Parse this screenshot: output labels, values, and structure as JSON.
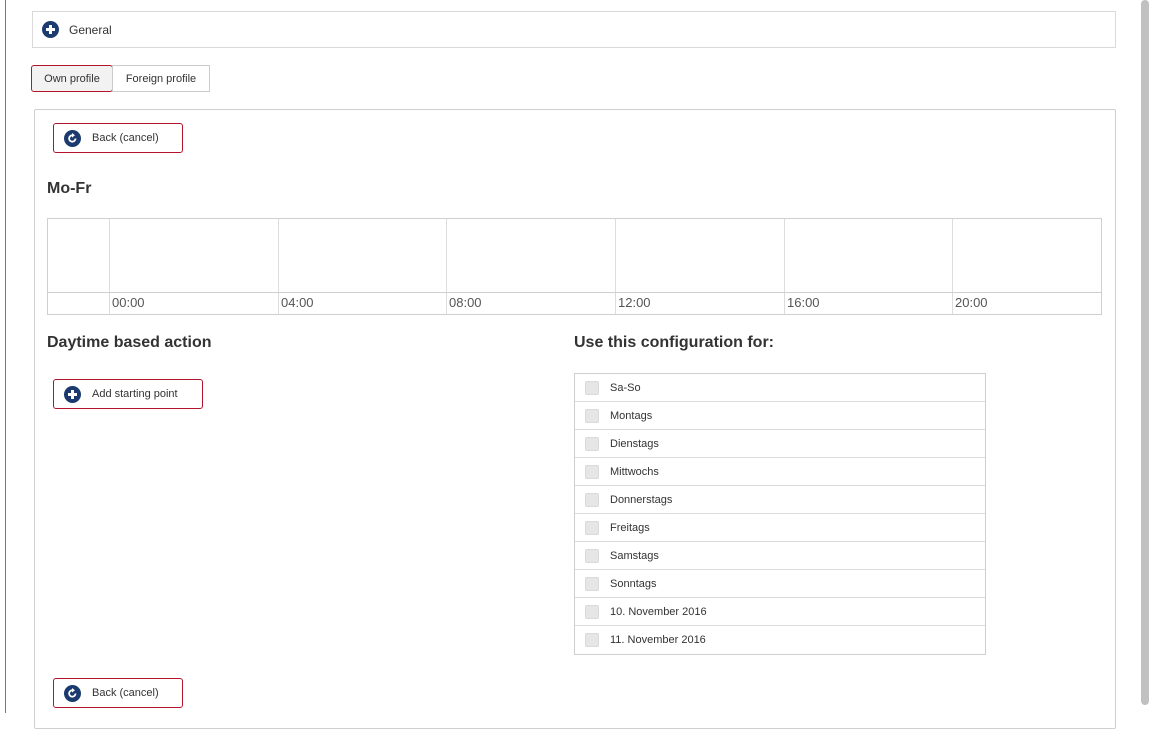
{
  "general": {
    "label": "General",
    "icon": "plus-circle-icon"
  },
  "tabs": [
    {
      "label": "Own profile",
      "active": true
    },
    {
      "label": "Foreign profile",
      "active": false
    }
  ],
  "buttons": {
    "back_top": "Back (cancel)",
    "back_bottom": "Back (cancel)",
    "add_starting_point": "Add starting point"
  },
  "schedule": {
    "title": "Mo-Fr",
    "time_labels": [
      "00:00",
      "04:00",
      "08:00",
      "12:00",
      "16:00",
      "20:00"
    ]
  },
  "daytime_section": {
    "title": "Daytime based action"
  },
  "config_section": {
    "title": "Use this configuration for:",
    "options": [
      {
        "label": "Sa-So",
        "checked": false
      },
      {
        "label": "Montags",
        "checked": false
      },
      {
        "label": "Dienstags",
        "checked": false
      },
      {
        "label": "Mittwochs",
        "checked": false
      },
      {
        "label": "Donnerstags",
        "checked": false
      },
      {
        "label": "Freitags",
        "checked": false
      },
      {
        "label": "Samstags",
        "checked": false
      },
      {
        "label": "Sonntags",
        "checked": false
      },
      {
        "label": "10. November 2016",
        "checked": false
      },
      {
        "label": "11. November 2016",
        "checked": false
      }
    ]
  },
  "colors": {
    "accent_border": "#b3132b",
    "icon": "#1b3a6e"
  }
}
